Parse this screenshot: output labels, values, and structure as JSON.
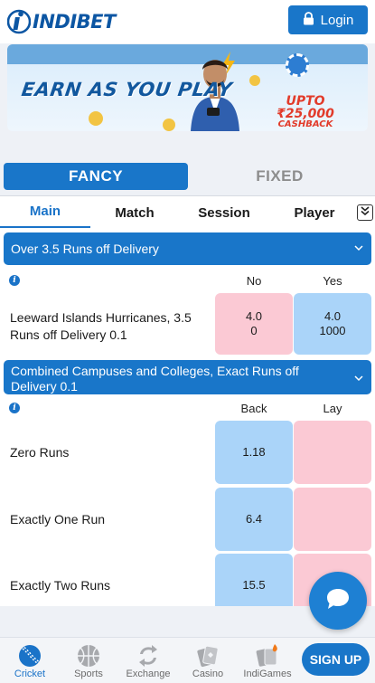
{
  "header": {
    "brand": "INDIBET",
    "login_label": "Login"
  },
  "banner": {
    "headline": "EARN AS YOU PLAY",
    "cashback_amount": "UPTO ₹25,000",
    "cashback_label": "CASHBACK"
  },
  "market_tabs": {
    "fancy": "FANCY",
    "fixed": "FIXED"
  },
  "sub_tabs": [
    "Main",
    "Match",
    "Session",
    "Player"
  ],
  "markets": [
    {
      "title": "Over 3.5 Runs off Delivery",
      "col1": "No",
      "col2": "Yes",
      "runners": [
        {
          "name": "Leeward Islands Hurricanes, 3.5 Runs off Delivery 0.1",
          "no_odds": "4.0",
          "no_size": "0",
          "yes_odds": "4.0",
          "yes_size": "1000"
        }
      ]
    },
    {
      "title": "Combined Campuses and Colleges, Exact Runs off Delivery 0.1",
      "col1": "Back",
      "col2": "Lay",
      "runners": [
        {
          "name": "Zero Runs",
          "back": "1.18",
          "lay": ""
        },
        {
          "name": "Exactly One Run",
          "back": "6.4",
          "lay": ""
        },
        {
          "name": "Exactly Two Runs",
          "back": "15.5",
          "lay": ""
        }
      ]
    }
  ],
  "bottom_nav": [
    "Cricket",
    "Sports",
    "Exchange",
    "Casino",
    "IndiGames"
  ],
  "signup_label": "SIGN UP",
  "colors": {
    "primary": "#1976c9",
    "back": "#aad4f9",
    "lay": "#fbc9d4"
  }
}
